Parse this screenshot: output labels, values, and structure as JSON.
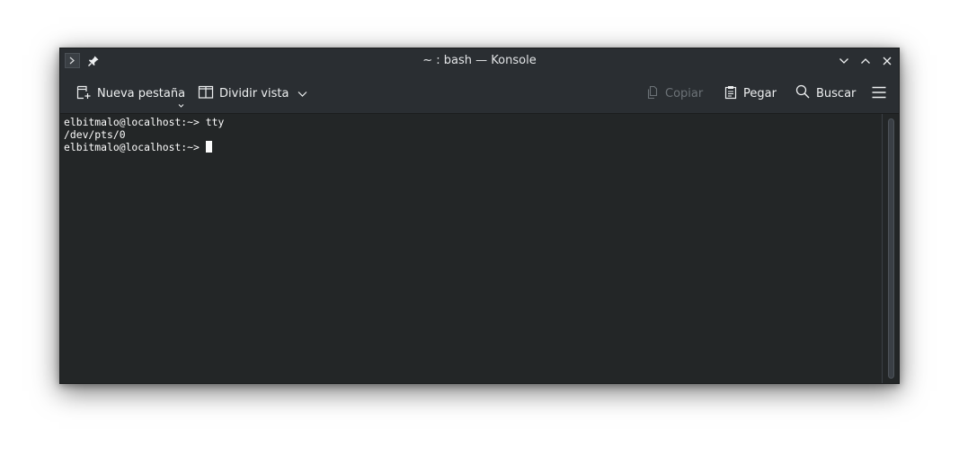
{
  "window": {
    "title": "~ : bash — Konsole"
  },
  "titlebar": {
    "icons": [
      "konsole-app-icon",
      "pin-icon",
      "minimize-icon",
      "maximize-icon",
      "close-icon"
    ]
  },
  "toolbar": {
    "new_tab_label": "Nueva pestaña",
    "split_view_label": "Dividir vista",
    "copy_label": "Copiar",
    "paste_label": "Pegar",
    "search_label": "Buscar"
  },
  "terminal": {
    "lines": [
      "elbitmalo@localhost:~> tty",
      "/dev/pts/0",
      "elbitmalo@localhost:~> "
    ]
  },
  "colors": {
    "background": "#232627",
    "titlebar": "#2a2e32",
    "text": "#fcfcfc",
    "disabled_text": "#6c7277"
  }
}
